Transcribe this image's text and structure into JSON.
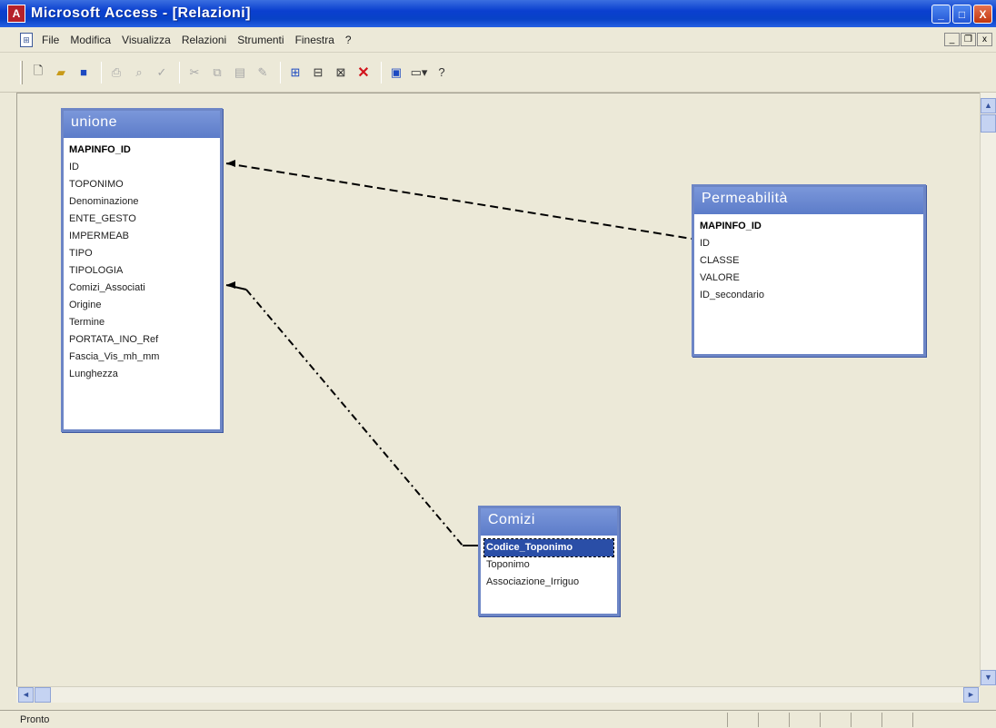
{
  "window": {
    "title": "Microsoft Access - [Relazioni]",
    "app_icon_glyph": "A",
    "minimize_glyph": "_",
    "maximize_glyph": "□",
    "close_glyph": "X"
  },
  "menubar": {
    "items": [
      "File",
      "Modifica",
      "Visualizza",
      "Relazioni",
      "Strumenti",
      "Finestra",
      "?"
    ],
    "doc_min": "_",
    "doc_restore": "❐",
    "doc_close": "x"
  },
  "tables": [
    {
      "title": "unione",
      "fields": [
        {
          "name": "MAPINFO_ID",
          "key": true
        },
        {
          "name": "ID",
          "key": false
        },
        {
          "name": "TOPONIMO",
          "key": false
        },
        {
          "name": "Denominazione",
          "key": false
        },
        {
          "name": "ENTE_GESTO",
          "key": false
        },
        {
          "name": "IMPERMEAB",
          "key": false
        },
        {
          "name": "TIPO",
          "key": false
        },
        {
          "name": "TIPOLOGIA",
          "key": false
        },
        {
          "name": "Comizi_Associati",
          "key": false
        },
        {
          "name": "Origine",
          "key": false
        },
        {
          "name": "Termine",
          "key": false
        },
        {
          "name": "PORTATA_INO_Ref",
          "key": false
        },
        {
          "name": "Fascia_Vis_mh_mm",
          "key": false
        },
        {
          "name": "Lunghezza",
          "key": false
        }
      ]
    },
    {
      "title": "Permeabilità",
      "fields": [
        {
          "name": "MAPINFO_ID",
          "key": true
        },
        {
          "name": "ID",
          "key": false
        },
        {
          "name": "CLASSE",
          "key": false
        },
        {
          "name": "VALORE",
          "key": false
        },
        {
          "name": "ID_secondario",
          "key": false
        }
      ]
    },
    {
      "title": "Comizi",
      "fields": [
        {
          "name": "Codice_Toponimo",
          "key": true,
          "selected": true
        },
        {
          "name": "Toponimo",
          "key": false
        },
        {
          "name": "Associazione_Irriguo",
          "key": false
        }
      ]
    }
  ],
  "status": {
    "text": "Pronto"
  },
  "scroll": {
    "up": "▲",
    "down": "▼",
    "left": "◄",
    "right": "►"
  }
}
